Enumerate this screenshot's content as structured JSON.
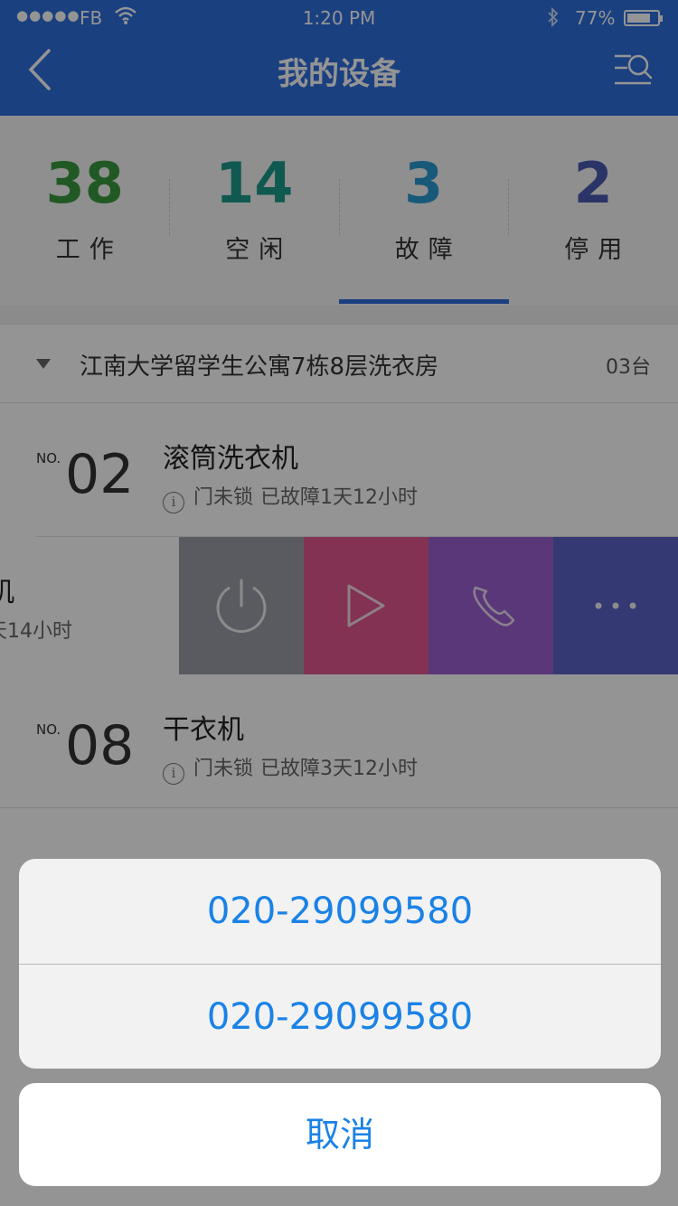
{
  "status_bar": {
    "carrier": "FB",
    "time": "1:20 PM",
    "battery_percent": "77%",
    "battery_level": 0.77
  },
  "nav": {
    "title": "我的设备"
  },
  "stats": [
    {
      "count": "38",
      "label": "工作",
      "color": "#3a9a3e"
    },
    {
      "count": "14",
      "label": "空闲",
      "color": "#1a9a8a"
    },
    {
      "count": "3",
      "label": "故障",
      "color": "#2a9ad2"
    },
    {
      "count": "2",
      "label": "停用",
      "color": "#4a5ab0"
    }
  ],
  "selected_stat": "故障",
  "group": {
    "title": "江南大学留学生公寓7栋8层洗衣房",
    "count": "03台"
  },
  "devices": [
    {
      "prefix": "NO.",
      "number": "02",
      "name": "滚筒洗衣机",
      "status": "门未锁",
      "duration": "已故障1天12小时"
    },
    {
      "partial_name": "机",
      "partial_info": "天14小时"
    },
    {
      "prefix": "NO.",
      "number": "08",
      "name": "干衣机",
      "status": "门未锁",
      "duration": "已故障3天12小时"
    }
  ],
  "swipe_actions": [
    {
      "icon": "power-icon",
      "color": "#9a9ea8"
    },
    {
      "icon": "play-icon",
      "color": "#e2578f"
    },
    {
      "icon": "phone-icon",
      "color": "#9b5fd0"
    },
    {
      "icon": "more-icon",
      "color": "#5a63c8"
    }
  ],
  "action_sheet": {
    "options": [
      "020-29099580",
      "020-29099580"
    ],
    "cancel_label": "取消"
  }
}
